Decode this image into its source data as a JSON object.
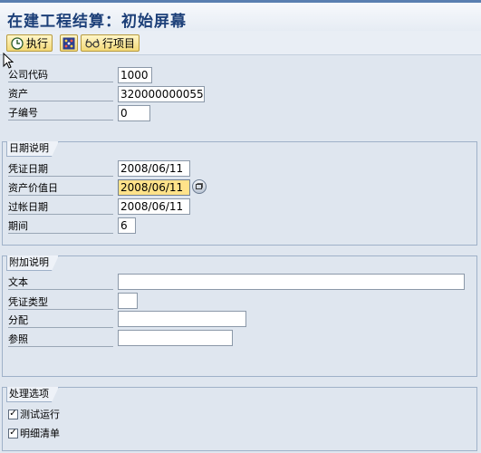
{
  "window": {
    "title": "在建工程结算：初始屏幕"
  },
  "toolbar": {
    "execute_label": "执行",
    "line_items_label": "行项目",
    "execute_icon": "clock-execute-icon",
    "selection_icon": "dynamic-selection-icon",
    "line_items_icon": "glasses-icon"
  },
  "header_fields": {
    "company_code": {
      "label": "公司代码",
      "value": "1000"
    },
    "asset": {
      "label": "资产",
      "value": "320000000055"
    },
    "sub_number": {
      "label": "子编号",
      "value": "0"
    }
  },
  "date_section": {
    "title": "日期说明",
    "document_date": {
      "label": "凭证日期",
      "value": "2008/06/11"
    },
    "asset_value_date": {
      "label": "资产价值日",
      "value": "2008/06/11"
    },
    "posting_date": {
      "label": "过帐日期",
      "value": "2008/06/11"
    },
    "period": {
      "label": "期间",
      "value": "6"
    }
  },
  "additional_section": {
    "title": "附加说明",
    "text": {
      "label": "文本",
      "value": ""
    },
    "document_type": {
      "label": "凭证类型",
      "value": ""
    },
    "assignment": {
      "label": "分配",
      "value": ""
    },
    "reference": {
      "label": "参照",
      "value": ""
    }
  },
  "processing_section": {
    "title": "处理选项",
    "test_run": {
      "label": "测试运行",
      "checked": true
    },
    "detail_list": {
      "label": "明细清单",
      "checked": true
    }
  }
}
